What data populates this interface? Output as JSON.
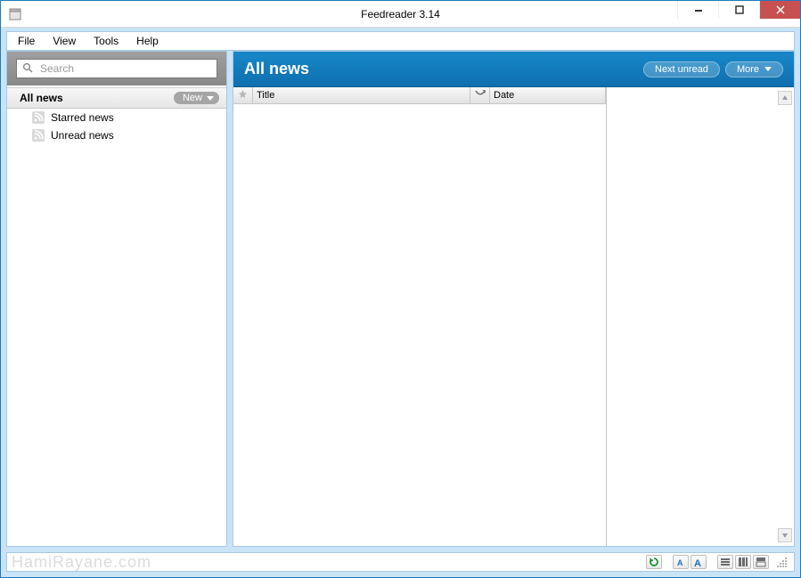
{
  "window": {
    "title": "Feedreader 3.14"
  },
  "menu": {
    "file": "File",
    "view": "View",
    "tools": "Tools",
    "help": "Help"
  },
  "sidebar": {
    "search_placeholder": "Search",
    "root": {
      "label": "All news",
      "new_button": "New"
    },
    "items": [
      {
        "label": "Starred news"
      },
      {
        "label": "Unread news"
      }
    ]
  },
  "header": {
    "title": "All news",
    "next_unread": "Next unread",
    "more": "More"
  },
  "columns": {
    "title": "Title",
    "date": "Date"
  },
  "watermark": "HamiRayane.com"
}
